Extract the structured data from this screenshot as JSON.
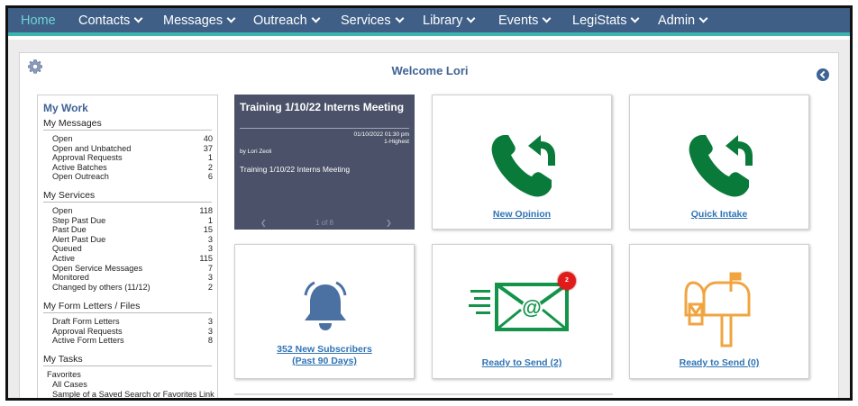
{
  "nav": {
    "items": [
      {
        "label": "Home",
        "active": true,
        "dropdown": false
      },
      {
        "label": "Contacts",
        "dropdown": true
      },
      {
        "label": "Messages",
        "dropdown": true
      },
      {
        "label": "Outreach",
        "dropdown": true
      },
      {
        "label": "Services",
        "dropdown": true
      },
      {
        "label": "Library",
        "dropdown": true
      },
      {
        "label": "Events",
        "dropdown": true
      },
      {
        "label": "LegiStats",
        "dropdown": true
      },
      {
        "label": "Admin",
        "dropdown": true
      }
    ]
  },
  "header": {
    "welcome": "Welcome Lori"
  },
  "my_work": {
    "title": "My Work",
    "messages": {
      "heading": "My Messages",
      "rows": [
        {
          "label": "Open",
          "count": "40"
        },
        {
          "label": "Open and Unbatched",
          "count": "37"
        },
        {
          "label": "Approval Requests",
          "count": "1"
        },
        {
          "label": "Active Batches",
          "count": "2"
        },
        {
          "label": "Open Outreach",
          "count": "6"
        }
      ]
    },
    "services": {
      "heading": "My Services",
      "rows": [
        {
          "label": "Open",
          "count": "118"
        },
        {
          "label": "Step Past Due",
          "count": "1"
        },
        {
          "label": "Past Due",
          "count": "15"
        },
        {
          "label": "Alert Past Due",
          "count": "3"
        },
        {
          "label": "Queued",
          "count": "3"
        },
        {
          "label": "Active",
          "count": "115"
        },
        {
          "label": "Open Service Messages",
          "count": "7"
        },
        {
          "label": "Monitored",
          "count": "3"
        },
        {
          "label": "Changed by others (11/12)",
          "count": "2"
        }
      ]
    },
    "form_letters": {
      "heading": "My Form Letters / Files",
      "rows": [
        {
          "label": "Draft Form Letters",
          "count": "3"
        },
        {
          "label": "Approval Requests",
          "count": "3"
        },
        {
          "label": "Active Form Letters",
          "count": "8"
        }
      ]
    },
    "tasks": {
      "heading": "My Tasks",
      "favorites_label": "Favorites",
      "items": [
        "All Cases",
        "Sample of a Saved Search or Favorites Link"
      ]
    }
  },
  "training": {
    "title": "Training 1/10/22 Interns Meeting",
    "datetime": "01/10/2022 01:30 pm",
    "priority": "1-Highest",
    "author": "by Lori Zeoli",
    "description": "Training 1/10/22 Interns Meeting",
    "pager": "1 of 8"
  },
  "tiles": {
    "new_opinion": {
      "label": "New Opinion",
      "icon": "phone-callback-icon"
    },
    "quick_intake": {
      "label": "Quick Intake",
      "icon": "phone-callback-icon"
    },
    "subscribers": {
      "line1": "352 New Subscribers",
      "line2": "(Past 90 Days)",
      "icon": "bell-icon"
    },
    "ready_email": {
      "label": "Ready to Send (2)",
      "badge": "2",
      "icon": "email-at-icon"
    },
    "ready_mail": {
      "label": "Ready to Send (0)",
      "icon": "mailbox-icon"
    }
  },
  "colors": {
    "nav_bg": "#3f5f87",
    "nav_accent": "#3cb4b0",
    "phone_green": "#0a7a3b",
    "email_green": "#13944a",
    "bell_blue": "#4b71a3",
    "mailbox_orange": "#f0a541",
    "link_blue": "#2f74b5",
    "badge_red": "#e11b1b"
  }
}
